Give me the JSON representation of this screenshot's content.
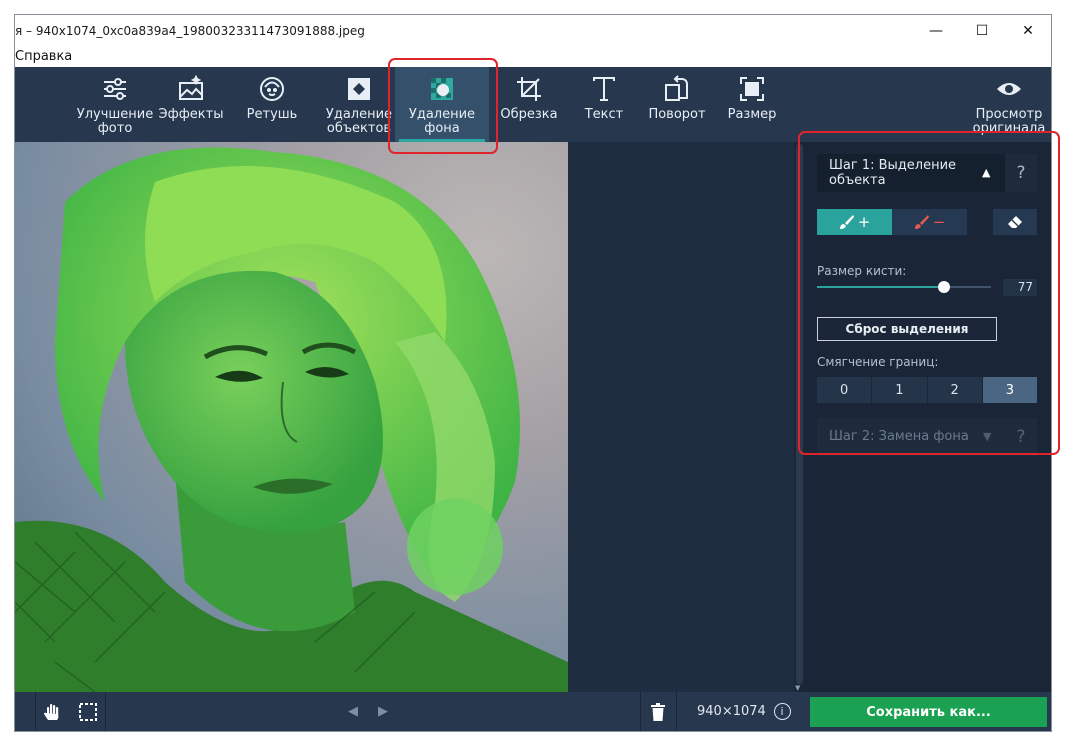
{
  "window": {
    "title": "я – 940x1074_0xc0a839a4_19800323311473091888.jpeg",
    "minimize": "—",
    "maximize": "☐",
    "close": "✕"
  },
  "menu": {
    "items": [
      "Справка"
    ]
  },
  "toolbar": {
    "tools": [
      {
        "label": "Улучшение\nфото",
        "icon": "sliders-icon"
      },
      {
        "label": "Эффекты",
        "icon": "effects-icon"
      },
      {
        "label": "Ретушь",
        "icon": "face-icon"
      },
      {
        "label": "Удаление\nобъектов",
        "icon": "object-remove-icon"
      },
      {
        "label": "Удаление\nфона",
        "icon": "background-remove-icon",
        "active": true
      },
      {
        "label": "Обрезка",
        "icon": "crop-icon"
      },
      {
        "label": "Текст",
        "icon": "text-icon"
      },
      {
        "label": "Поворот",
        "icon": "rotate-icon"
      },
      {
        "label": "Размер",
        "icon": "resize-icon"
      },
      {
        "label": "Просмотр\nоригинала",
        "icon": "eye-icon"
      }
    ]
  },
  "panel": {
    "step1": {
      "label": "Шаг 1: Выделение объекта",
      "help": "?"
    },
    "brush_add_symbol": "+",
    "brush_remove_symbol": "−",
    "brush_size": {
      "label": "Размер кисти:",
      "value": "77",
      "fraction": 0.73
    },
    "reset_label": "Сброс выделения",
    "feather": {
      "label": "Смягчение границ:",
      "options": [
        "0",
        "1",
        "2",
        "3"
      ],
      "selected": 3
    },
    "step2": {
      "label": "Шаг 2: Замена фона",
      "help": "?"
    }
  },
  "bottom": {
    "dimensions": "940×1074",
    "info": "i",
    "save_label": "Сохранить как..."
  },
  "colors": {
    "accent": "#2aa39c",
    "save": "#1ba152",
    "highlight": "#e0242c",
    "mask": "#3bd24a"
  }
}
